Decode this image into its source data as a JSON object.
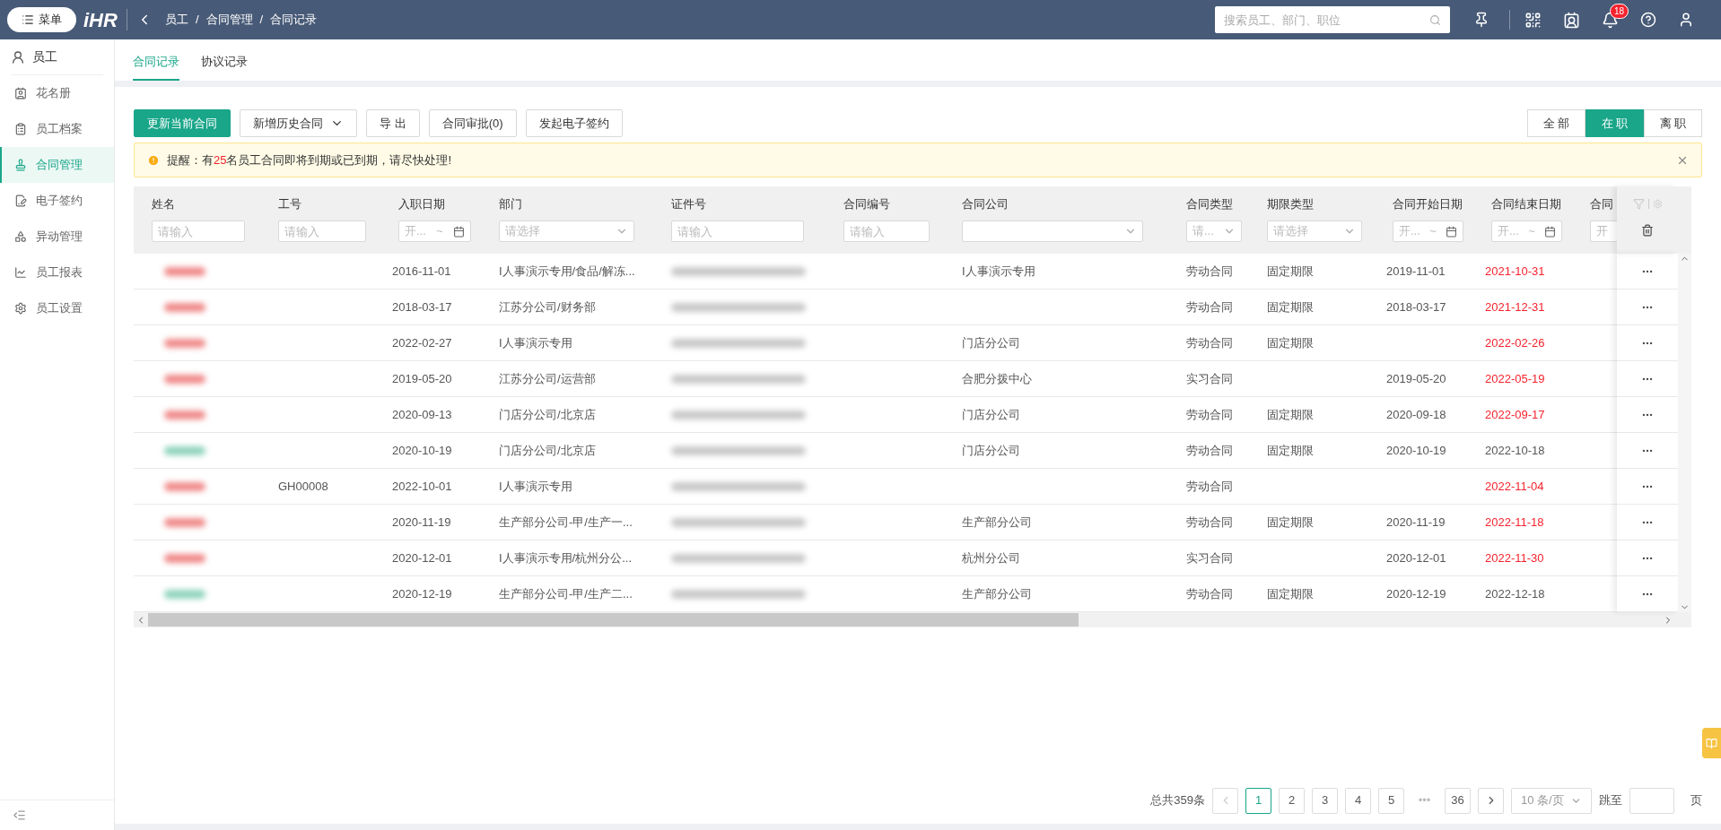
{
  "topbar": {
    "menu_button": "菜单",
    "logo": "iHR",
    "breadcrumb": [
      "员工",
      "合同管理",
      "合同记录"
    ],
    "breadcrumb_separator": "/",
    "search": {
      "placeholder": "搜索员工、部门、职位"
    },
    "notification_count": "18"
  },
  "sidebar": {
    "title": "员工",
    "items": [
      {
        "label": "花名册",
        "selected": false
      },
      {
        "label": "员工档案",
        "selected": false
      },
      {
        "label": "合同管理",
        "selected": true
      },
      {
        "label": "电子签约",
        "selected": false
      },
      {
        "label": "异动管理",
        "selected": false
      },
      {
        "label": "员工报表",
        "selected": false
      },
      {
        "label": "员工设置",
        "selected": false
      }
    ]
  },
  "tabs": [
    {
      "label": "合同记录",
      "selected": true
    },
    {
      "label": "协议记录",
      "selected": false
    }
  ],
  "toolbar": {
    "buttons": [
      {
        "label": "更新当前合同",
        "kind": "primary"
      },
      {
        "label": "新增历史合同",
        "kind": "dropdown"
      },
      {
        "label": "导 出",
        "kind": "default"
      },
      {
        "label": "合同审批(0)",
        "kind": "default"
      },
      {
        "label": "发起电子签约",
        "kind": "default"
      }
    ],
    "status_filter": [
      {
        "label": "全 部",
        "selected": false
      },
      {
        "label": "在 职",
        "selected": true
      },
      {
        "label": "离 职",
        "selected": false
      }
    ]
  },
  "alert": {
    "text_before": "提醒：有",
    "count": "25",
    "text_after": "名员工合同即将到期或已到期，请尽快处理!"
  },
  "table": {
    "columns": [
      {
        "label": "姓名",
        "filter": {
          "kind": "text",
          "placeholder": "请输入"
        }
      },
      {
        "label": "工号",
        "filter": {
          "kind": "text",
          "placeholder": "请输入"
        }
      },
      {
        "label": "入职日期",
        "filter": {
          "kind": "date",
          "placeholder": "开...",
          "separator": "~"
        }
      },
      {
        "label": "部门",
        "filter": {
          "kind": "select",
          "placeholder": "请选择"
        }
      },
      {
        "label": "证件号",
        "filter": {
          "kind": "text",
          "placeholder": "请输入"
        }
      },
      {
        "label": "合同编号",
        "filter": {
          "kind": "text",
          "placeholder": "请输入"
        }
      },
      {
        "label": "合同公司",
        "filter": {
          "kind": "select"
        }
      },
      {
        "label": "合同类型",
        "filter": {
          "kind": "select",
          "placeholder": "请..."
        }
      },
      {
        "label": "期限类型",
        "filter": {
          "kind": "select",
          "placeholder": "请选择"
        }
      },
      {
        "label": "合同开始日期",
        "filter": {
          "kind": "date",
          "placeholder": "开...",
          "separator": "~"
        }
      },
      {
        "label": "合同结束日期",
        "filter": {
          "kind": "date",
          "placeholder": "开...",
          "separator": "~"
        }
      },
      {
        "label": "合同",
        "filter": {
          "kind": "cut",
          "placeholder": "开"
        }
      }
    ],
    "rows": [
      {
        "color": "#f08a8a",
        "employee_no": "",
        "hire_date": "2016-11-01",
        "department": "I人事演示专用/食品/解冻...",
        "company": "I人事演示专用",
        "contract_type": "劳动合同",
        "term_type": "固定期限",
        "start_date": "2019-11-01",
        "end_date": "2021-10-31",
        "end_alert": true
      },
      {
        "color": "#f08a8a",
        "employee_no": "",
        "hire_date": "2018-03-17",
        "department": "江苏分公司/财务部",
        "company": "",
        "contract_type": "劳动合同",
        "term_type": "固定期限",
        "start_date": "2018-03-17",
        "end_date": "2021-12-31",
        "end_alert": true
      },
      {
        "color": "#f08a8a",
        "employee_no": "",
        "hire_date": "2022-02-27",
        "department": "I人事演示专用",
        "company": "门店分公司",
        "contract_type": "劳动合同",
        "term_type": "固定期限",
        "start_date": "",
        "end_date": "2022-02-26",
        "end_alert": true
      },
      {
        "color": "#f08a8a",
        "employee_no": "",
        "hire_date": "2019-05-20",
        "department": "江苏分公司/运营部",
        "company": "合肥分拨中心",
        "contract_type": "实习合同",
        "term_type": "",
        "start_date": "2019-05-20",
        "end_date": "2022-05-19",
        "end_alert": true
      },
      {
        "color": "#f08a8a",
        "employee_no": "",
        "hire_date": "2020-09-13",
        "department": "门店分公司/北京店",
        "company": "门店分公司",
        "contract_type": "劳动合同",
        "term_type": "固定期限",
        "start_date": "2020-09-18",
        "end_date": "2022-09-17",
        "end_alert": true
      },
      {
        "color": "#8fd3bd",
        "employee_no": "",
        "hire_date": "2020-10-19",
        "department": "门店分公司/北京店",
        "company": "门店分公司",
        "contract_type": "劳动合同",
        "term_type": "固定期限",
        "start_date": "2020-10-19",
        "end_date": "2022-10-18",
        "end_alert": false
      },
      {
        "color": "#f08a8a",
        "employee_no": "GH00008",
        "hire_date": "2022-10-01",
        "department": "I人事演示专用",
        "company": "",
        "contract_type": "劳动合同",
        "term_type": "",
        "start_date": "",
        "end_date": "2022-11-04",
        "end_alert": true
      },
      {
        "color": "#f08a8a",
        "employee_no": "",
        "hire_date": "2020-11-19",
        "department": "生产部分公司-甲/生产一...",
        "company": "生产部分公司",
        "contract_type": "劳动合同",
        "term_type": "固定期限",
        "start_date": "2020-11-19",
        "end_date": "2022-11-18",
        "end_alert": true
      },
      {
        "color": "#f08a8a",
        "employee_no": "",
        "hire_date": "2020-12-01",
        "department": "I人事演示专用/杭州分公...",
        "company": "杭州分公司",
        "contract_type": "实习合同",
        "term_type": "",
        "start_date": "2020-12-01",
        "end_date": "2022-11-30",
        "end_alert": true
      },
      {
        "color": "#8fd3bd",
        "employee_no": "",
        "hire_date": "2020-12-19",
        "department": "生产部分公司-甲/生产二...",
        "company": "生产部分公司",
        "contract_type": "劳动合同",
        "term_type": "固定期限",
        "start_date": "2020-12-19",
        "end_date": "2022-12-18",
        "end_alert": false
      }
    ]
  },
  "pagination": {
    "total": "总共359条",
    "pages": [
      {
        "label": "1",
        "selected": true
      },
      {
        "label": "2",
        "selected": false
      },
      {
        "label": "3",
        "selected": false
      },
      {
        "label": "4",
        "selected": false
      },
      {
        "label": "5",
        "selected": false
      },
      {
        "label": "•••",
        "kind": "ellipsis"
      },
      {
        "label": "36",
        "selected": false
      }
    ],
    "page_size": "10 条/页",
    "jump_label": "跳至",
    "page_unit": "页"
  }
}
